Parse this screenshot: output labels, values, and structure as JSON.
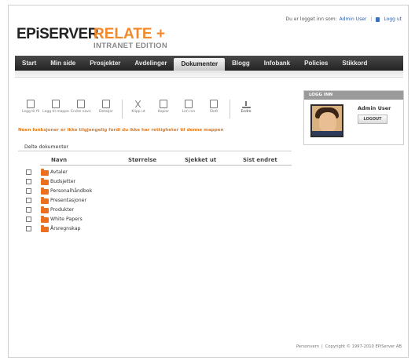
{
  "logo": {
    "brand": "EPiSERVER",
    "product": "RELATE +",
    "edition": "INTRANET EDITION"
  },
  "header": {
    "logged_in_text": "Du er logget inn som:",
    "user": "Admin User",
    "logout_link": "Logg ut"
  },
  "nav": {
    "items": [
      {
        "label": "Start"
      },
      {
        "label": "Min side"
      },
      {
        "label": "Prosjekter"
      },
      {
        "label": "Avdelinger"
      },
      {
        "label": "Dokumenter"
      },
      {
        "label": "Blogg"
      },
      {
        "label": "Infobank"
      },
      {
        "label": "Policies"
      },
      {
        "label": "Stikkord"
      }
    ],
    "active": "Dokumenter"
  },
  "toolbar": {
    "buttons": [
      {
        "label": "Legg til fil",
        "icon": "file-add-icon",
        "enabled": false
      },
      {
        "label": "Legg til mappe",
        "icon": "folder-add-icon",
        "enabled": false
      },
      {
        "label": "Endre navn",
        "icon": "rename-icon",
        "enabled": false
      },
      {
        "label": "Detaljer",
        "icon": "details-icon",
        "enabled": false
      },
      {
        "label": "Klipp ut",
        "icon": "cut-icon",
        "enabled": false
      },
      {
        "label": "Kopier",
        "icon": "copy-icon",
        "enabled": false
      },
      {
        "label": "Lim inn",
        "icon": "paste-icon",
        "enabled": false
      },
      {
        "label": "Slett",
        "icon": "delete-icon",
        "enabled": false
      },
      {
        "label": "Endre",
        "icon": "upload-icon",
        "enabled": true
      }
    ]
  },
  "notice": "Noen funksjoner er ikke tilgjengelig fordi du ikke har rettigheter til denne mappen",
  "section_title": "Delte dokumenter",
  "table": {
    "headers": {
      "name": "Navn",
      "size": "Størrelse",
      "checked_out": "Sjekket ut",
      "modified": "Sist endret"
    },
    "rows": [
      {
        "name": "Avtaler"
      },
      {
        "name": "Budsjetter"
      },
      {
        "name": "Personalhåndbok"
      },
      {
        "name": "Presentasjoner"
      },
      {
        "name": "Produkter"
      },
      {
        "name": "White Papers"
      },
      {
        "name": "Årsregnskap"
      }
    ]
  },
  "login_box": {
    "title": "LOGG INN",
    "user": "Admin User",
    "logout_button": "LOGOUT"
  },
  "footer": {
    "link": "Personvern",
    "copyright": "Copyright © 1997-2010 EPiServer AB"
  },
  "colors": {
    "accent": "#f28a2b",
    "folder": "#ea6f1e",
    "nav_bg": "#2e2e2e",
    "notice": "#e07a20"
  }
}
